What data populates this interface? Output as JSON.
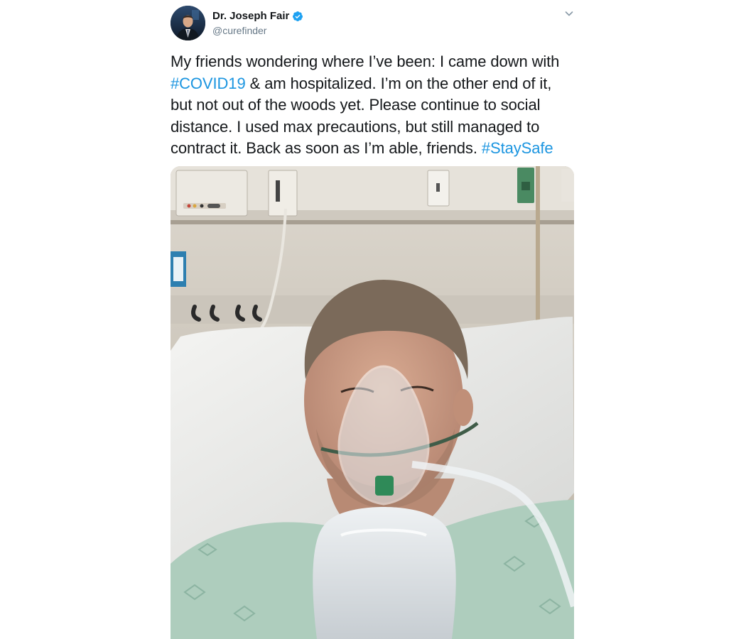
{
  "author": {
    "display_name": "Dr. Joseph Fair",
    "handle": "@curefinder",
    "verified": true,
    "avatar_icon": "profile-photo",
    "verified_icon": "verified-badge-icon",
    "verified_color": "#1da1f2"
  },
  "menu": {
    "icon": "chevron-down-icon"
  },
  "tweet": {
    "line1": "My friends wondering where I’ve been: I came down with",
    "hashtag1": "#COVID19",
    "line2_rest": " & am hospitalized. I’m on the other end of it,",
    "line3": "but not out of the woods yet. Please continue to social",
    "line4": "distance. I used max precautions, but still managed to",
    "line5": "contract it. Back as soon as I’m able, friends.",
    "hashtag2": "#StaySafe",
    "hashtag_color": "#1b95e0",
    "text_color": "#14171a"
  },
  "media": {
    "kind": "photo",
    "subject": "hospital-selfie"
  }
}
